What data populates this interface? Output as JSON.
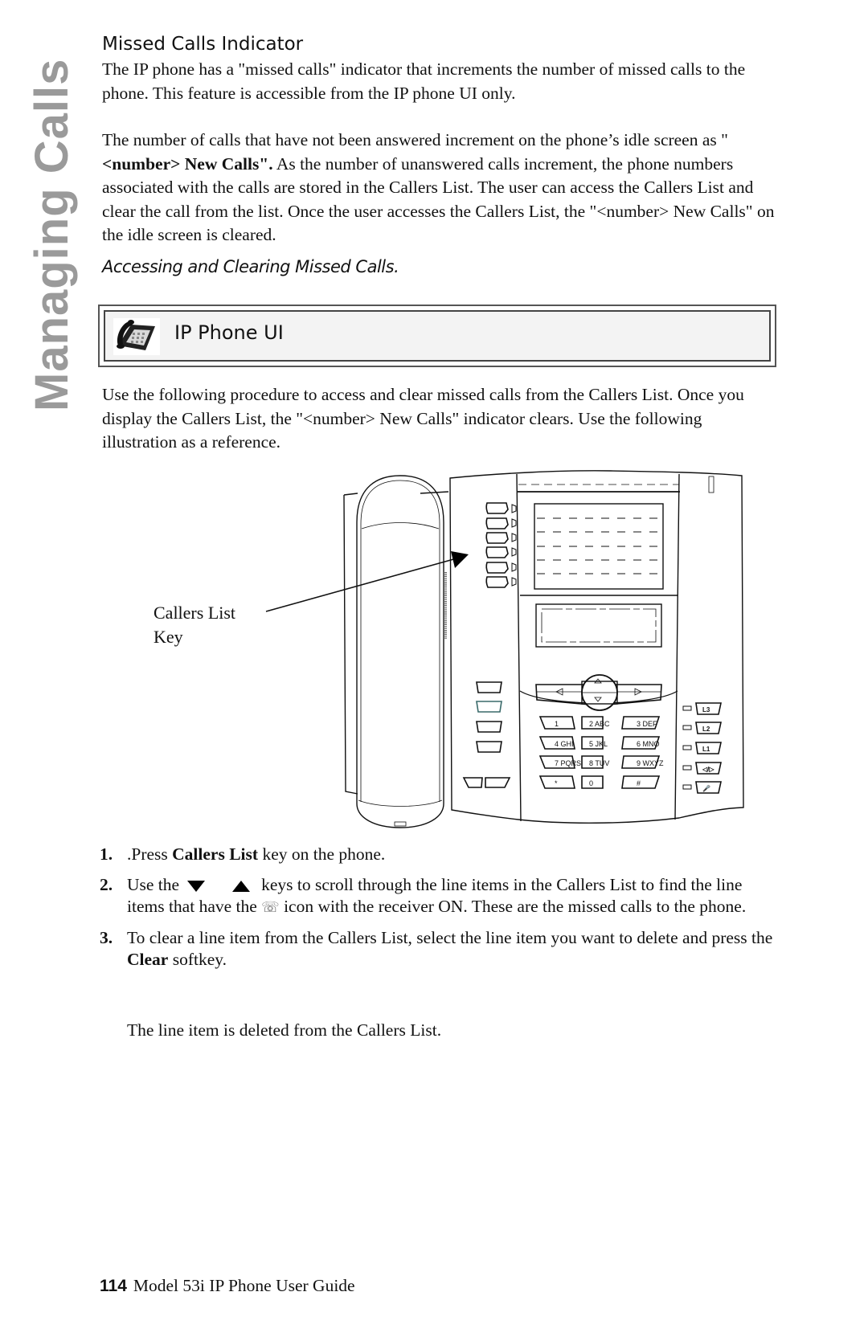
{
  "side_title": "Managing Calls",
  "section": {
    "heading": "Missed Calls Indicator",
    "paragraph1": "The IP phone has a \"missed calls\" indicator that increments the number of missed calls to the phone. This feature is accessible from the IP phone UI only.",
    "paragraph2": {
      "part1": "The number of calls that have not been answered increment on the phone’s idle screen as \"",
      "bold": "<number> New Calls\".",
      "part2": " As the number of unanswered calls increment, the phone numbers associated with the calls are stored in the Callers List. The user can access the Callers List and clear the call from the list. Once the user accesses the Callers List, the \"<number> New Calls\" on the idle screen is cleared."
    },
    "subheading": "Accessing and Clearing Missed Calls."
  },
  "ui_box": {
    "icon": "desk-phone-icon",
    "label": "IP Phone UI"
  },
  "intro": "Use the following procedure to access and clear missed calls from the Callers List. Once you display the Callers List, the \"<number> New Calls\" indicator clears. Use the following illustration as a reference.",
  "illustration": {
    "callout_line1": "Callers List",
    "callout_line2": "Key",
    "keypad": [
      [
        "1",
        ""
      ],
      [
        "2",
        "ABC"
      ],
      [
        "3",
        "DEF"
      ],
      [
        "4",
        "GHI"
      ],
      [
        "5",
        "JKL"
      ],
      [
        "6",
        "MNO"
      ],
      [
        "7",
        "PQRS"
      ],
      [
        "8",
        "TUV"
      ],
      [
        "9",
        "WXYZ"
      ],
      [
        "*",
        ""
      ],
      [
        "0",
        ""
      ],
      [
        "#",
        ""
      ]
    ],
    "line_keys": [
      "L3",
      "L2",
      "L1",
      "◁/▷",
      "🎤"
    ]
  },
  "steps": [
    {
      "num": "1.",
      "pre": ".Press ",
      "bold": "Callers List",
      "post": " key on the phone."
    },
    {
      "num": "2.",
      "pre": "Use the",
      "down_icon": "down-arrow-icon",
      "up_icon": "up-arrow-icon",
      "mid": "keys to scroll through the line items in the Callers List to find the line items that have the",
      "phone_icon": "☏",
      "post": " icon with the receiver ON. These are the missed calls to the phone."
    },
    {
      "num": "3.",
      "pre": "To clear a line item from the Callers List, select the line item you want to delete and press the ",
      "bold": "Clear",
      "post": " softkey."
    }
  ],
  "result": "The line item is deleted from the Callers List.",
  "footer": {
    "page_number": "114",
    "guide_title": "Model 53i IP Phone User Guide"
  }
}
